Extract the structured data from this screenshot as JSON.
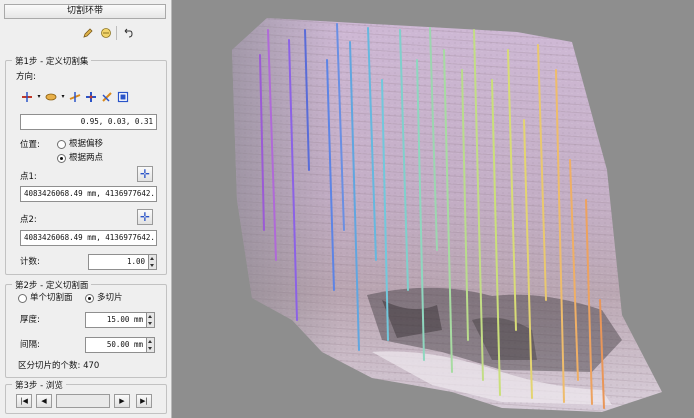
{
  "panel": {
    "title": "切割环带",
    "tools": [
      "pencil-icon",
      "layers-icon",
      "undo-icon"
    ]
  },
  "step1": {
    "title": "第1步 - 定义切割集",
    "direction_label": "方向:",
    "direction_icons": [
      "axis-x-icon",
      "axis-y-icon",
      "axis-z-icon",
      "axis-custom-icon",
      "axis-view-icon",
      "axis-pick-icon"
    ],
    "direction_value": "0.95, 0.03, 0.31",
    "position_label": "位置:",
    "position_options": [
      "根据偏移",
      "根据两点"
    ],
    "position_selected": 1,
    "point1_label": "点1:",
    "point1_value": "4083426068.49 mm, 4136977642.",
    "point2_label": "点2:",
    "point2_value": "4083426068.49 mm, 4136977642.",
    "count_label": "计数:",
    "count_value": "1.00"
  },
  "step2": {
    "title": "第2步 - 定义切割面",
    "options": [
      "单个切割面",
      "多切片"
    ],
    "selected": 1,
    "thickness_label": "厚度:",
    "thickness_value": "15.00 mm",
    "spacing_label": "间隔:",
    "spacing_value": "50.00 mm",
    "slice_count_text": "区分切片的个数: 470"
  },
  "step3": {
    "title": "第3步 - 浏览"
  },
  "colors": {
    "panel_bg": "#efefef",
    "viewport_bg": "#8e8e8e",
    "pick_icon": "#2a54c8"
  }
}
